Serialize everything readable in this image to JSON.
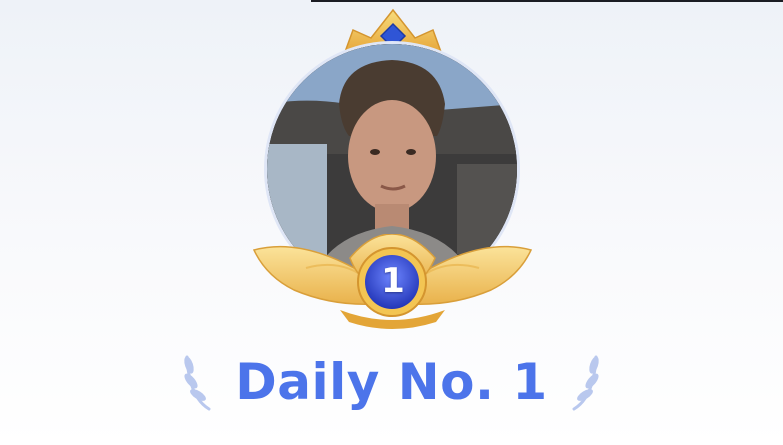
{
  "badge": {
    "rank": "1",
    "title": "Daily No. 1"
  },
  "colors": {
    "title_blue": "#4c74ea",
    "gold": "#f3c553",
    "gold_dark": "#e3a537",
    "medal_blue": "#3548c6",
    "laurel": "#b9c8ee"
  },
  "icons": {
    "crown": "crown-icon",
    "wings": "laurel-wings-icon",
    "medal": "rank-medal-icon",
    "laurel_left": "laurel-left-icon",
    "laurel_right": "laurel-right-icon"
  }
}
